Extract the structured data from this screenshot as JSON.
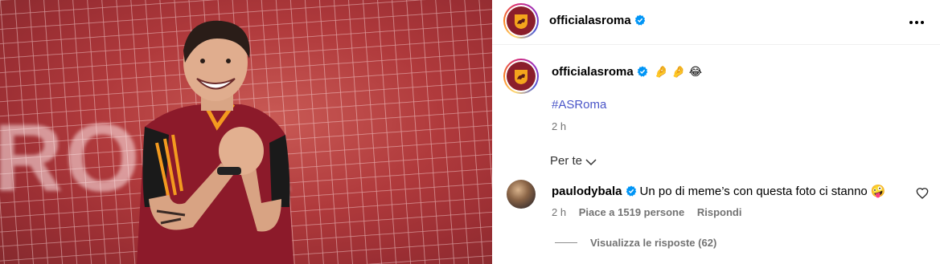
{
  "post": {
    "account": "officialasroma",
    "image_alt": "Paulo Dybala laughing during training",
    "banner_text": "ROMA"
  },
  "header": {
    "username": "officialasroma",
    "more_icon": "more-horizontal-icon"
  },
  "caption": {
    "username": "officialasroma",
    "emojis": [
      "🤌",
      "🤌",
      "😂"
    ],
    "hashtag": "#ASRoma",
    "time": "2 h"
  },
  "filter": {
    "label": "Per te",
    "icon": "chevron-down-icon"
  },
  "comment": {
    "username": "paulodybala",
    "text": "Un po di meme’s con questa foto ci stanno 🤪",
    "time": "2 h",
    "likes": "Piace a 1519 persone",
    "reply": "Rispondi",
    "view_replies": "Visualizza le risposte (62)"
  },
  "colors": {
    "verified": "#0095f6",
    "hashtag": "#4a55c8",
    "meta": "#737373"
  }
}
